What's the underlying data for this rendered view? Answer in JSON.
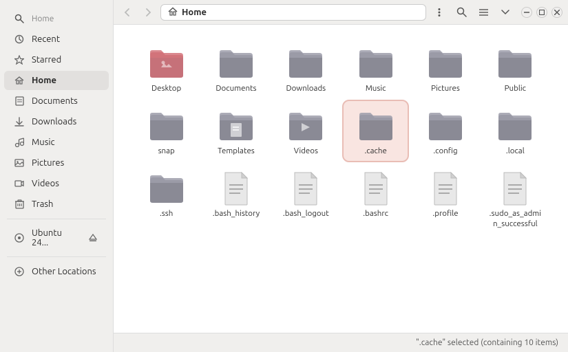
{
  "window": {
    "title": "Home",
    "status_text": "\".cache\" selected (containing 10 items)"
  },
  "titlebar": {
    "back_label": "‹",
    "forward_label": "›",
    "location_icon": "🏠",
    "location_text": "Home",
    "menu_icon": "⋮",
    "search_icon": "🔍",
    "view_icon": "☰",
    "chevron_icon": "⌄",
    "minimize_icon": "—",
    "maximize_icon": "□",
    "close_icon": "✕"
  },
  "sidebar": {
    "items": [
      {
        "id": "recent",
        "label": "Recent",
        "icon": "🕐"
      },
      {
        "id": "starred",
        "label": "Starred",
        "icon": "★"
      },
      {
        "id": "home",
        "label": "Home",
        "icon": "🏠",
        "active": true
      },
      {
        "id": "documents",
        "label": "Documents",
        "icon": "📄"
      },
      {
        "id": "downloads",
        "label": "Downloads",
        "icon": "⬇"
      },
      {
        "id": "music",
        "label": "Music",
        "icon": "♪"
      },
      {
        "id": "pictures",
        "label": "Pictures",
        "icon": "🖼"
      },
      {
        "id": "videos",
        "label": "Videos",
        "icon": "🎞"
      },
      {
        "id": "trash",
        "label": "Trash",
        "icon": "🗑"
      }
    ],
    "devices": [
      {
        "id": "ubuntu",
        "label": "Ubuntu 24...",
        "icon": "⬤",
        "eject": true
      }
    ],
    "other": [
      {
        "id": "other-locations",
        "label": "Other Locations",
        "icon": "+"
      }
    ]
  },
  "files": {
    "items": [
      {
        "id": "desktop",
        "label": "Desktop",
        "type": "folder",
        "variant": "pink",
        "selected": false
      },
      {
        "id": "documents",
        "label": "Documents",
        "type": "folder",
        "variant": "gray",
        "selected": false
      },
      {
        "id": "downloads",
        "label": "Downloads",
        "type": "folder",
        "variant": "gray",
        "selected": false
      },
      {
        "id": "music",
        "label": "Music",
        "type": "folder",
        "variant": "gray",
        "selected": false
      },
      {
        "id": "pictures",
        "label": "Pictures",
        "type": "folder",
        "variant": "gray",
        "selected": false
      },
      {
        "id": "public",
        "label": "Public",
        "type": "folder",
        "variant": "gray",
        "selected": false
      },
      {
        "id": "snap",
        "label": "snap",
        "type": "folder",
        "variant": "gray",
        "selected": false
      },
      {
        "id": "templates",
        "label": "Templates",
        "type": "folder",
        "variant": "gray-template",
        "selected": false
      },
      {
        "id": "videos",
        "label": "Videos",
        "type": "folder",
        "variant": "gray-video",
        "selected": false
      },
      {
        "id": "cache",
        "label": ".cache",
        "type": "folder",
        "variant": "gray",
        "selected": true
      },
      {
        "id": "config",
        "label": ".config",
        "type": "folder",
        "variant": "gray",
        "selected": false
      },
      {
        "id": "local",
        "label": ".local",
        "type": "folder",
        "variant": "gray",
        "selected": false
      },
      {
        "id": "ssh",
        "label": ".ssh",
        "type": "folder",
        "variant": "gray",
        "selected": false
      },
      {
        "id": "bash-history",
        "label": ".bash_history",
        "type": "file",
        "variant": "text",
        "selected": false
      },
      {
        "id": "bash-logout",
        "label": ".bash_logout",
        "type": "file",
        "variant": "text",
        "selected": false
      },
      {
        "id": "bashrc",
        "label": ".bashrc",
        "type": "file",
        "variant": "text",
        "selected": false
      },
      {
        "id": "profile",
        "label": ".profile",
        "type": "file",
        "variant": "text",
        "selected": false
      },
      {
        "id": "sudo",
        "label": ".sudo_as_admin_successful",
        "type": "file",
        "variant": "text",
        "selected": false
      }
    ]
  }
}
